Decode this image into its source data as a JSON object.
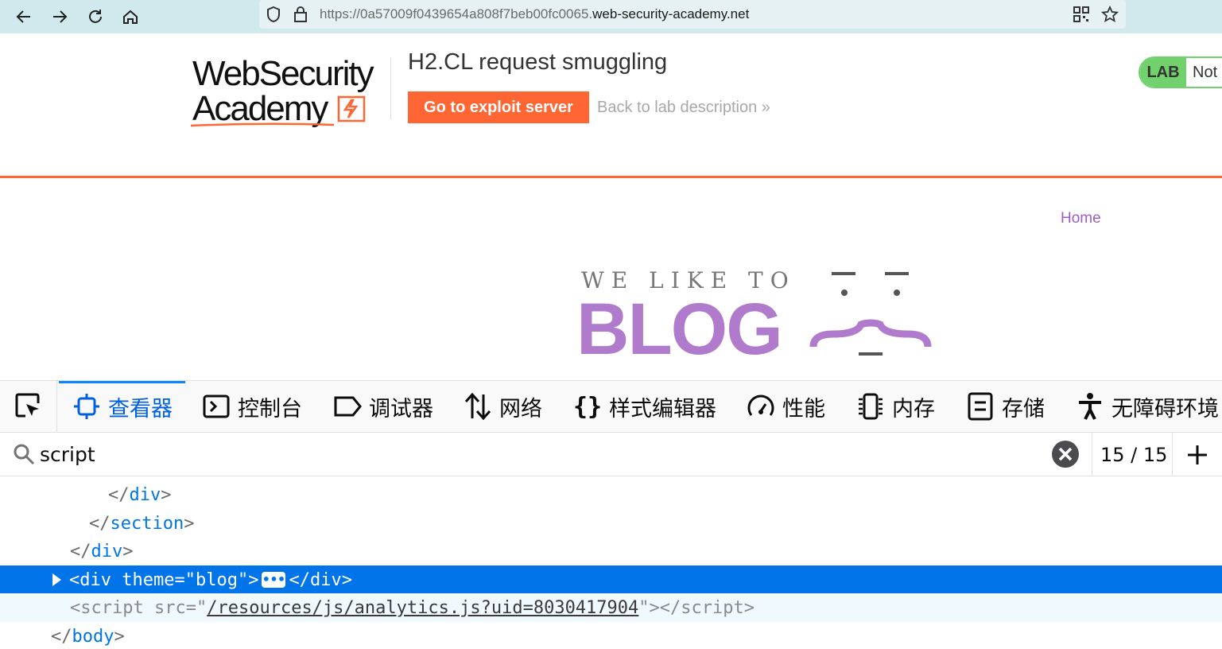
{
  "browser": {
    "url_prefix": "https://0a57009f0439654a808f7beb00fc0065.",
    "url_domain": "web-security-academy.net"
  },
  "lab_header": {
    "logo_line1": "WebSecurity",
    "logo_line2": "Academy",
    "title": "H2.CL request smuggling",
    "exploit_button": "Go to exploit server",
    "back_link": "Back to lab description",
    "back_link_chevron": "»",
    "status_badge": "LAB",
    "status_text": "Not"
  },
  "blog": {
    "nav_home": "Home",
    "tagline": "WE LIKE TO",
    "word": "BLOG"
  },
  "devtools": {
    "tabs": [
      {
        "label": "查看器",
        "icon": "inspector-icon"
      },
      {
        "label": "控制台",
        "icon": "console-icon"
      },
      {
        "label": "调试器",
        "icon": "debugger-icon"
      },
      {
        "label": "网络",
        "icon": "network-icon"
      },
      {
        "label": "样式编辑器",
        "icon": "style-editor-icon"
      },
      {
        "label": "性能",
        "icon": "performance-icon"
      },
      {
        "label": "内存",
        "icon": "memory-icon"
      },
      {
        "label": "存储",
        "icon": "storage-icon"
      },
      {
        "label": "无障碍环境",
        "icon": "accessibility-icon"
      }
    ],
    "search": {
      "value": "script",
      "match_count": "15 / 15"
    },
    "markup": {
      "line1_tag": "div",
      "line2_tag": "section",
      "line3_tag": "div",
      "line4_tag": "div",
      "line4_attr": "theme",
      "line4_value": "blog",
      "line5_tag": "script",
      "line5_attr": "src",
      "line5_value": "/resources/js/analytics.js?uid=8030417904",
      "line6_tag": "body"
    }
  },
  "colors": {
    "accent_orange": "#ff6633",
    "blog_purple": "#b07bcc",
    "lab_green": "#70d16d",
    "devtools_blue": "#0074e8"
  }
}
